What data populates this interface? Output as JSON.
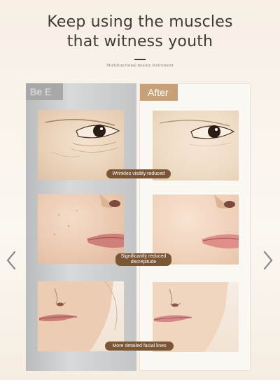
{
  "header": {
    "title_line1": "Keep using the muscles",
    "title_line2": "that witness youth",
    "subtitle": "Multifunctional beauty instrument"
  },
  "comparison": {
    "before_label": "Be    E",
    "after_label": "After",
    "captions": {
      "row1": "Wrinkles visibly reduced",
      "row2_line1": "Significantly reduced",
      "row2_line2": "decrepitude",
      "row3": "More detailed facial lines"
    }
  },
  "nav": {
    "prev_icon": "chevron-left-icon",
    "next_icon": "chevron-right-icon"
  }
}
